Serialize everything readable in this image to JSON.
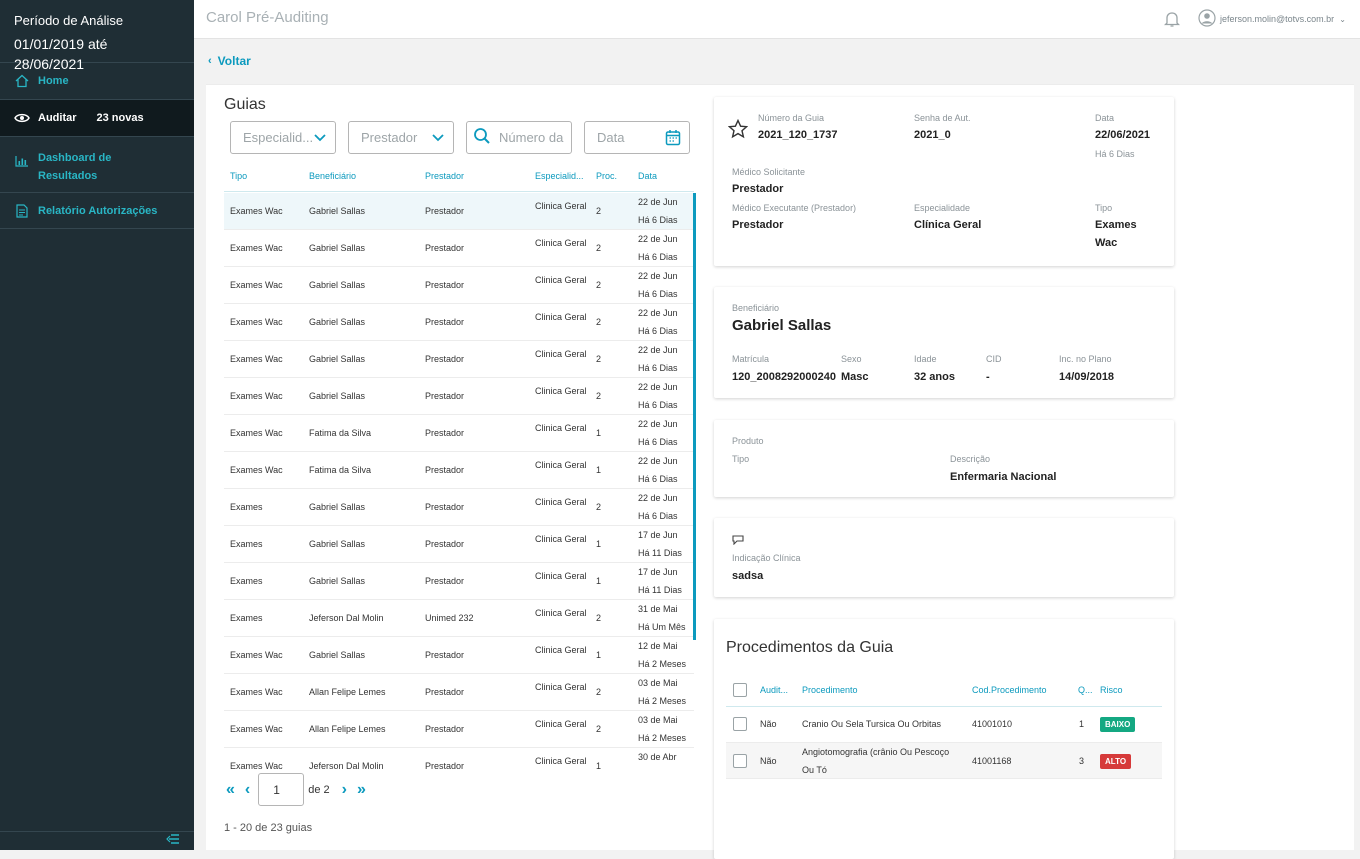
{
  "sidebar": {
    "period_label": "Período de Análise",
    "period_range": "01/01/2019 até 28/06/2021",
    "items": [
      {
        "label": "Home"
      },
      {
        "label": "Auditar",
        "badge": "23 novas"
      },
      {
        "label_line1": "Dashboard de",
        "label_line2": "Resultados"
      },
      {
        "label": "Relatório Autorizações"
      }
    ]
  },
  "topbar": {
    "title": "Carol Pré-Auditing",
    "user_email": "jeferson.molin@totvs.com.br"
  },
  "back_label": "Voltar",
  "guias": {
    "title": "Guias",
    "filters": {
      "especialidade": "Especialid...",
      "prestador": "Prestador",
      "numero_placeholder": "Número da",
      "data_placeholder": "Data"
    },
    "columns": [
      "Tipo",
      "Beneficiário",
      "Prestador",
      "Especialid...",
      "Proc.",
      "Data"
    ],
    "rows": [
      {
        "tipo": "Exames Wac",
        "beneficiario": "Gabriel Sallas",
        "prestador": "Prestador",
        "especialidade": "Clinica Geral",
        "proc": "2",
        "data": "22 de Jun",
        "ago": "Há 6 Dias"
      },
      {
        "tipo": "Exames Wac",
        "beneficiario": "Gabriel Sallas",
        "prestador": "Prestador",
        "especialidade": "Clinica Geral",
        "proc": "2",
        "data": "22 de Jun",
        "ago": "Há 6 Dias"
      },
      {
        "tipo": "Exames Wac",
        "beneficiario": "Gabriel Sallas",
        "prestador": "Prestador",
        "especialidade": "Clinica Geral",
        "proc": "2",
        "data": "22 de Jun",
        "ago": "Há 6 Dias"
      },
      {
        "tipo": "Exames Wac",
        "beneficiario": "Gabriel Sallas",
        "prestador": "Prestador",
        "especialidade": "Clinica Geral",
        "proc": "2",
        "data": "22 de Jun",
        "ago": "Há 6 Dias"
      },
      {
        "tipo": "Exames Wac",
        "beneficiario": "Gabriel Sallas",
        "prestador": "Prestador",
        "especialidade": "Clinica Geral",
        "proc": "2",
        "data": "22 de Jun",
        "ago": "Há 6 Dias"
      },
      {
        "tipo": "Exames Wac",
        "beneficiario": "Gabriel Sallas",
        "prestador": "Prestador",
        "especialidade": "Clinica Geral",
        "proc": "2",
        "data": "22 de Jun",
        "ago": "Há 6 Dias"
      },
      {
        "tipo": "Exames Wac",
        "beneficiario": "Fatima da Silva",
        "prestador": "Prestador",
        "especialidade": "Clinica Geral",
        "proc": "1",
        "data": "22 de Jun",
        "ago": "Há 6 Dias"
      },
      {
        "tipo": "Exames Wac",
        "beneficiario": "Fatima da Silva",
        "prestador": "Prestador",
        "especialidade": "Clinica Geral",
        "proc": "1",
        "data": "22 de Jun",
        "ago": "Há 6 Dias"
      },
      {
        "tipo": "Exames",
        "beneficiario": "Gabriel Sallas",
        "prestador": "Prestador",
        "especialidade": "Clinica Geral",
        "proc": "2",
        "data": "22 de Jun",
        "ago": "Há 6 Dias"
      },
      {
        "tipo": "Exames",
        "beneficiario": "Gabriel Sallas",
        "prestador": "Prestador",
        "especialidade": "Clinica Geral",
        "proc": "1",
        "data": "17 de Jun",
        "ago": "Há 11 Dias"
      },
      {
        "tipo": "Exames",
        "beneficiario": "Gabriel Sallas",
        "prestador": "Prestador",
        "especialidade": "Clinica Geral",
        "proc": "1",
        "data": "17 de Jun",
        "ago": "Há 11 Dias"
      },
      {
        "tipo": "Exames",
        "beneficiario": "Jeferson Dal Molin",
        "prestador": "Unimed 232",
        "especialidade": "Clinica Geral",
        "proc": "2",
        "data": "31 de Mai",
        "ago": "Há Um Mês"
      },
      {
        "tipo": "Exames Wac",
        "beneficiario": "Gabriel Sallas",
        "prestador": "Prestador",
        "especialidade": "Clinica Geral",
        "proc": "1",
        "data": "12 de Mai",
        "ago": "Há 2 Meses"
      },
      {
        "tipo": "Exames Wac",
        "beneficiario": "Allan Felipe Lemes",
        "prestador": "Prestador",
        "especialidade": "Clinica Geral",
        "proc": "2",
        "data": "03 de Mai",
        "ago": "Há 2 Meses"
      },
      {
        "tipo": "Exames Wac",
        "beneficiario": "Allan Felipe Lemes",
        "prestador": "Prestador",
        "especialidade": "Clinica Geral",
        "proc": "2",
        "data": "03 de Mai",
        "ago": "Há 2 Meses"
      },
      {
        "tipo": "Exames Wac",
        "beneficiario": "Jeferson Dal Molin",
        "prestador": "Prestador",
        "especialidade": "Clinica Geral",
        "proc": "1",
        "data": "30 de Abr",
        "ago": ""
      }
    ],
    "pagination": {
      "page": "1",
      "of_label": "de 2",
      "summary": "1 - 20 de 23 guias"
    }
  },
  "guia_info": {
    "numero_label": "Número da Guia",
    "numero": "2021_120_1737",
    "senha_label": "Senha de Aut.",
    "senha": "2021_0",
    "data_label": "Data",
    "data": "22/06/2021",
    "data_ago": "Há 6 Dias",
    "solicitante_label": "Médico Solicitante",
    "solicitante": "Prestador",
    "executante_label": "Médico Executante (Prestador)",
    "executante": "Prestador",
    "especialidade_label": "Especialidade",
    "especialidade": "Clínica Geral",
    "tipo_label": "Tipo",
    "tipo_line1": "Exames",
    "tipo_line2": "Wac"
  },
  "beneficiario": {
    "label": "Beneficiário",
    "name": "Gabriel Sallas",
    "matricula_label": "Matrícula",
    "matricula": "120_2008292000240",
    "sexo_label": "Sexo",
    "sexo": "Masc",
    "idade_label": "Idade",
    "idade": "32 anos",
    "cid_label": "CID",
    "cid": "-",
    "inicio_label": "Inc. no Plano",
    "inicio": "14/09/2018"
  },
  "produto": {
    "label": "Produto",
    "tipo_label": "Tipo",
    "descricao_label": "Descrição",
    "descricao": "Enfermaria Nacional"
  },
  "indicacao": {
    "label": "Indicação Clínica",
    "value": "sadsa"
  },
  "procedimentos": {
    "title": "Procedimentos da Guia",
    "columns": [
      "Audit...",
      "Procedimento",
      "Cod.Procedimento",
      "Q...",
      "Risco"
    ],
    "rows": [
      {
        "auditado": "Não",
        "procedimento_l1": "Cranio Ou Sela Tursica Ou Orbitas",
        "procedimento_l2": "",
        "codigo": "41001010",
        "qtd": "1",
        "risco": "BAIXO"
      },
      {
        "auditado": "Não",
        "procedimento_l1": "Angiotomografia (crânio Ou Pescoço",
        "procedimento_l2": "Ou Tó",
        "codigo": "41001168",
        "qtd": "3",
        "risco": "ALTO"
      }
    ]
  },
  "colors": {
    "sidebar_bg": "#1f2e35",
    "accent": "#0c9abe",
    "nav_text": "#29b6c5",
    "risk_low": "#14a882",
    "risk_high": "#d63a3a"
  }
}
